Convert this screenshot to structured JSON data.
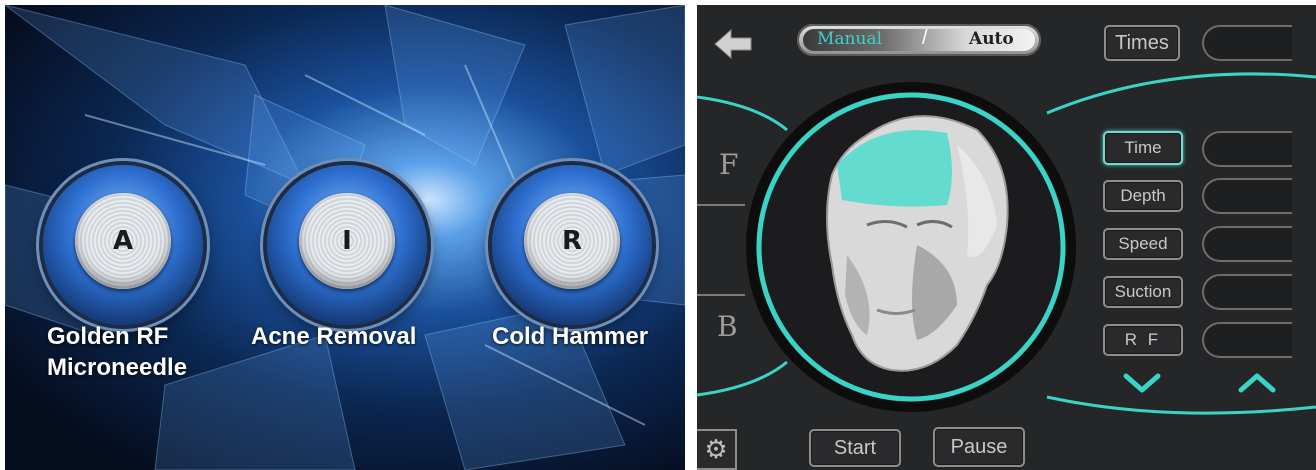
{
  "left_panel": {
    "modes": [
      {
        "letter": "A",
        "label_line1": "Golden RF",
        "label_line2": "Microneedle"
      },
      {
        "letter": "I",
        "label_line1": "Acne Removal",
        "label_line2": ""
      },
      {
        "letter": "R",
        "label_line1": "Cold Hammer",
        "label_line2": ""
      }
    ]
  },
  "right_panel": {
    "back_icon": "left-arrow-icon",
    "mode_toggle": {
      "manual": "Manual",
      "separator": "/",
      "auto": "Auto",
      "selected": "Manual"
    },
    "times_label": "Times",
    "side_labels": {
      "front": "F",
      "back": "B"
    },
    "parameters": [
      {
        "label": "Time",
        "active": true
      },
      {
        "label": "Depth",
        "active": false
      },
      {
        "label": "Speed",
        "active": false
      },
      {
        "label": "Suction",
        "active": false
      },
      {
        "label": "R F",
        "active": false
      }
    ],
    "decrease_icon": "chevron-down-icon",
    "increase_icon": "chevron-up-icon",
    "settings_icon": "gear-icon",
    "start_label": "Start",
    "pause_label": "Pause",
    "colors": {
      "accent": "#39d4c6",
      "panel_bg": "#252628",
      "button_border": "#8d8d8d"
    }
  }
}
